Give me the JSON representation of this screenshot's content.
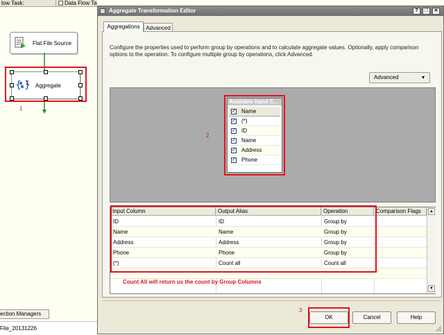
{
  "designer": {
    "tab_control_flow": "low Task:",
    "tab_data_flow": "Data Flow Task",
    "components": {
      "source_label": "Flat File Source",
      "aggregate_label": "Aggregate"
    },
    "callout_1": "1",
    "connection_managers_tab": "ection Managers",
    "status_text": "File_20131226"
  },
  "dialog": {
    "title": "Aggregate Transformation Editor",
    "tabs": {
      "aggregations": "Aggregations",
      "advanced": "Advanced"
    },
    "description": "Configure the properties used to perform group by operations and to calculate aggregate values. Optionally, apply comparison options to the operation. To configure multiple group by operations, click Advanced.",
    "advanced_button": "Advanced",
    "advanced_arrow": "▾",
    "input_table": {
      "title": "Available Input C...",
      "header": "Name",
      "rows": [
        {
          "label": "(*)",
          "checked": true
        },
        {
          "label": "ID",
          "checked": true
        },
        {
          "label": "Name",
          "checked": true
        },
        {
          "label": "Address",
          "checked": true
        },
        {
          "label": "Phone",
          "checked": true
        }
      ]
    },
    "callout_2": "2",
    "grid": {
      "headers": [
        "Input Column",
        "Output Alias",
        "Operation",
        "Comparison Flags"
      ],
      "rows": [
        [
          "ID",
          "ID",
          "Group by"
        ],
        [
          "Name",
          "Name",
          "Group by"
        ],
        [
          "Address",
          "Address",
          "Group by"
        ],
        [
          "Phone",
          "Phone",
          "Group by"
        ],
        [
          "(*)",
          "Count all",
          "Count all"
        ]
      ],
      "note": "Count All will return us the count by Group Columns"
    },
    "buttons": {
      "ok": "OK",
      "cancel": "Cancel",
      "help": "Help"
    },
    "callout_3": "3",
    "window_buttons": {
      "help": "?",
      "maximize": "□",
      "close": "✕"
    }
  },
  "colors": {
    "annotation_red": "#e0131b",
    "titlebar": "#7a7a7a",
    "dialog_face": "#ece9d8",
    "designer_surface": "#ababab"
  }
}
